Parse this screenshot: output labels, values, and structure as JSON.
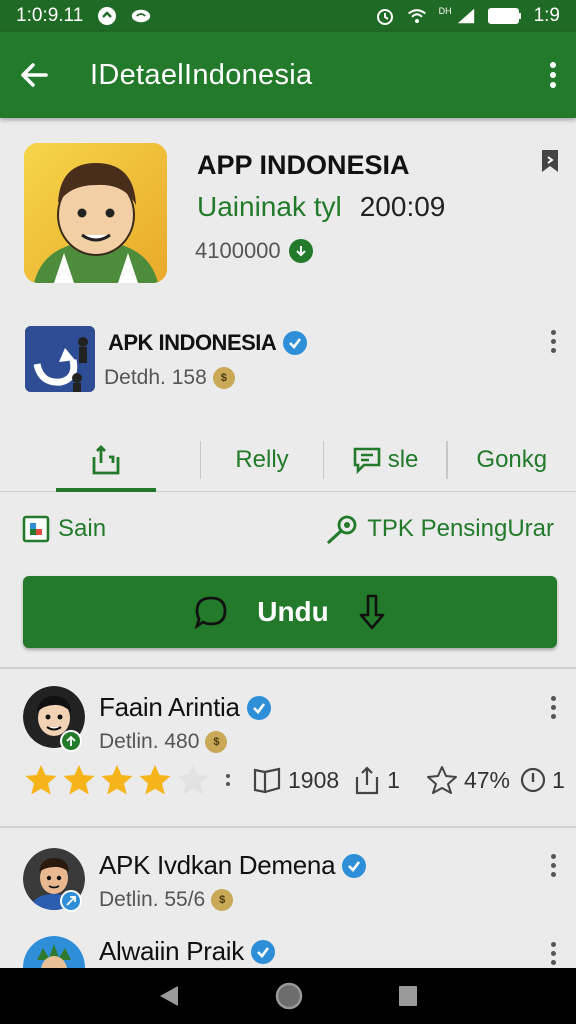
{
  "status_bar": {
    "time_left": "1:0:9.11",
    "network_label": "DH",
    "time_right": "1:9"
  },
  "app_bar": {
    "title": "IDetaelIndonesia",
    "icons": [
      "arrow-back-icon",
      "more-vert-icon"
    ]
  },
  "app": {
    "name": "APP INDONESIA",
    "sub_green": "Uaininak tyl",
    "sub_dark": "200:09",
    "count": "4100000"
  },
  "developer": {
    "name": "APK INDONESIA",
    "meta": "Detdh. 158"
  },
  "tabs": [
    {
      "label": "",
      "icon": "share-box-icon",
      "active": true
    },
    {
      "label": "Relly",
      "icon": "",
      "active": false
    },
    {
      "label": "sle",
      "icon": "message-icon",
      "active": false
    },
    {
      "label": "Gonkg",
      "icon": "",
      "active": false
    }
  ],
  "links": {
    "left": "Sain",
    "right": "TPK PensingUrar"
  },
  "download_button": {
    "label": "Undu"
  },
  "reviews": [
    {
      "name": "Faain Arintia",
      "meta": "Detlin. 480",
      "rating": 4,
      "stats": {
        "comments": "1908",
        "shares": "1",
        "stars": "47%",
        "alerts": "1"
      }
    },
    {
      "name": "APK Ivdkan Demena",
      "meta": "Detlin. 55/6"
    },
    {
      "name": "Alwaiin Praik"
    }
  ],
  "colors": {
    "primary": "#227a2a",
    "status_bar": "#1f6a24",
    "verified": "#2e8fd8",
    "background": "#ebebeb"
  }
}
